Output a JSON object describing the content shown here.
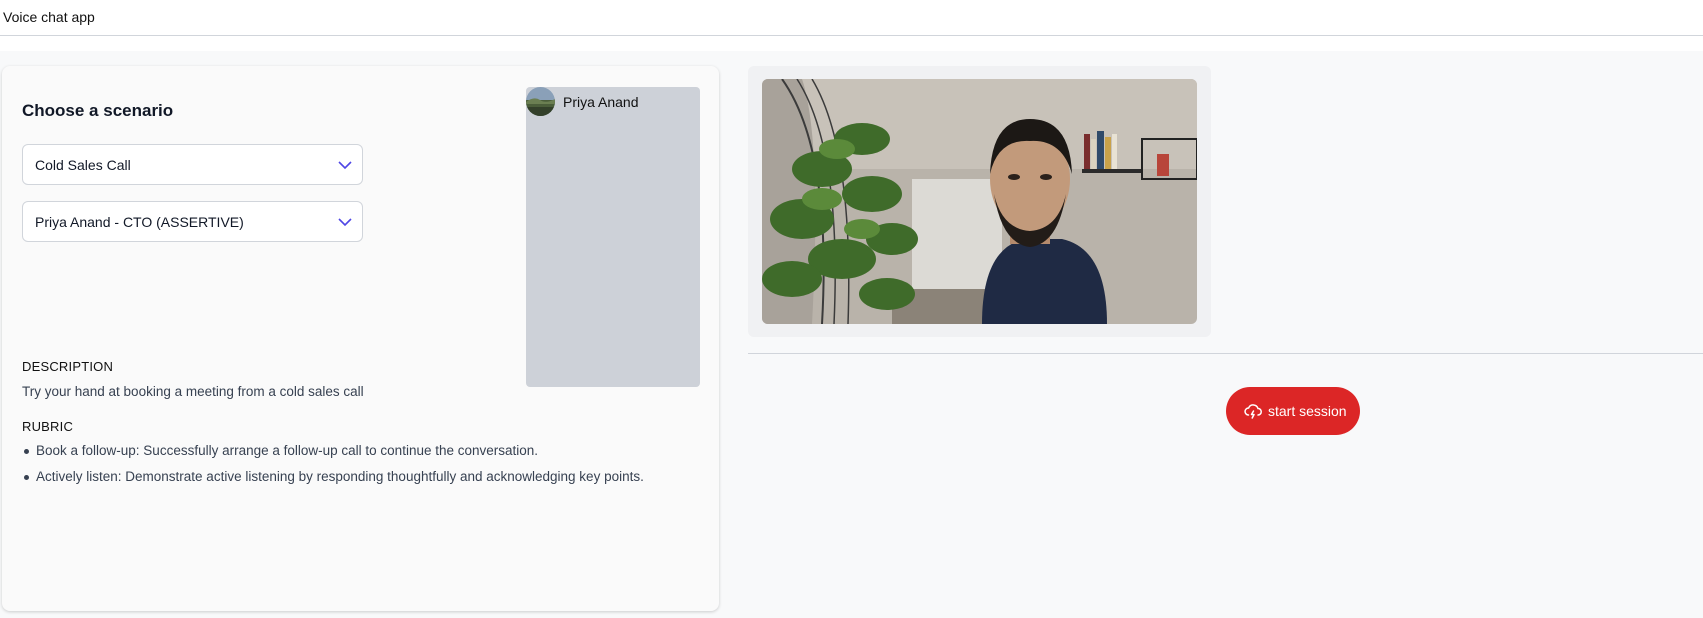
{
  "app": {
    "title": "Voice chat app"
  },
  "scenario": {
    "heading": "Choose a scenario",
    "scenario_select": {
      "value": "Cold Sales Call"
    },
    "persona_select": {
      "value": "Priya Anand - CTO (ASSERTIVE)"
    }
  },
  "persona_card": {
    "name": "Priya Anand"
  },
  "description": {
    "label": "DESCRIPTION",
    "text": "Try your hand at booking a meeting from a cold sales call"
  },
  "rubric": {
    "label": "RUBRIC",
    "items": [
      "Book a follow-up: Successfully arrange a follow-up call to continue the conversation.",
      "Actively listen: Demonstrate active listening by responding thoughtfully and acknowledging key points."
    ]
  },
  "session": {
    "start_label": "start session"
  },
  "colors": {
    "accent": "#dc2626",
    "chevron": "#4f46e5"
  }
}
